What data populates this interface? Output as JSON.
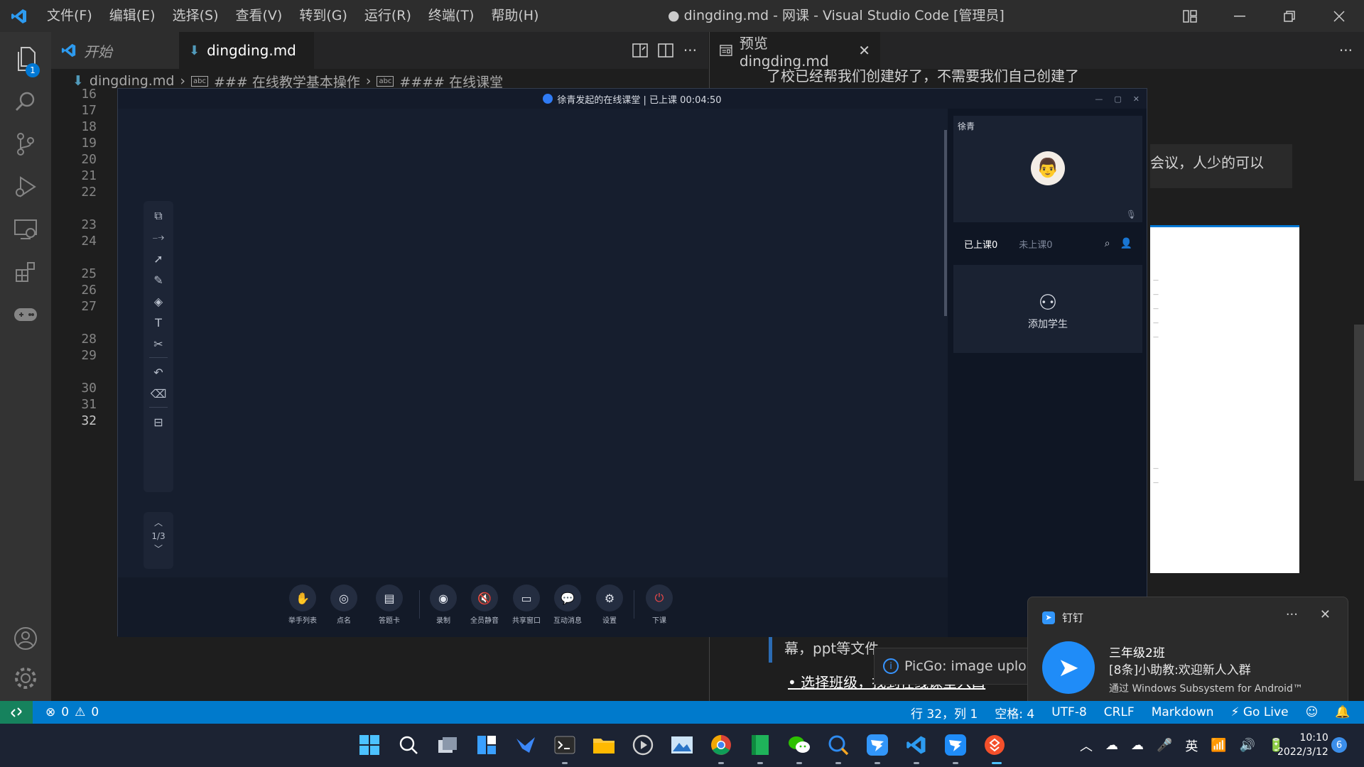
{
  "titlebar": {
    "menu": [
      "文件(F)",
      "编辑(E)",
      "选择(S)",
      "查看(V)",
      "转到(G)",
      "运行(R)",
      "终端(T)",
      "帮助(H)"
    ],
    "window_title": "● dingding.md - 网课 - Visual Studio Code [管理员]"
  },
  "activity": {
    "explorer_badge": "1"
  },
  "editor": {
    "tabs": [
      {
        "label": "开始"
      },
      {
        "label": "dingding.md"
      }
    ],
    "breadcrumb": [
      "dingding.md",
      "### 在线教学基本操作",
      "#### 在线课堂"
    ],
    "line_numbers": [
      "16",
      "17",
      "18",
      "19",
      "20",
      "21",
      "22",
      "23",
      "24",
      "25",
      "26",
      "27",
      "28",
      "29",
      "30",
      "31",
      "32"
    ],
    "active_line": "32"
  },
  "preview": {
    "tab_label": "预览 dingding.md",
    "top_text": "了校已经帮我们创建好了，不需要我们自己创建了",
    "block_text": "会议，人少的可以",
    "line1": "幕，ppt等文件",
    "line2": "选择班级，找到在线课堂入口"
  },
  "classroom": {
    "title": "徐青发起的在线课堂 | 已上课 00:04:50",
    "teacher_name": "徐青",
    "tab_attended": "已上课0",
    "tab_absent": "未上课0",
    "add_student": "添加学生",
    "page_indicator": "1/3",
    "bottom_actions": [
      "举手列表",
      "点名",
      "答题卡",
      "录制",
      "全员静音",
      "共享窗口",
      "互动消息",
      "设置",
      "下课"
    ]
  },
  "picgo": {
    "text": "PicGo: image upload"
  },
  "notification": {
    "app": "钉钉",
    "title": "三年级2班",
    "body": "[8条]小助教:欢迎新人入群",
    "via": "通过 Windows Subsystem for Android™"
  },
  "statusbar": {
    "errors": "0",
    "warnings": "0",
    "position": "行 32，列 1",
    "spaces": "空格: 4",
    "encoding": "UTF-8",
    "eol": "CRLF",
    "language": "Markdown",
    "golive": "Go Live"
  },
  "taskbar": {
    "ime": "英",
    "time": "10:10",
    "date": "2022/3/12",
    "notification_count": "6"
  },
  "colors": {
    "accent": "#007acc",
    "classroom_bg": "#161e2e",
    "dingtalk_blue": "#1f8cf8"
  }
}
